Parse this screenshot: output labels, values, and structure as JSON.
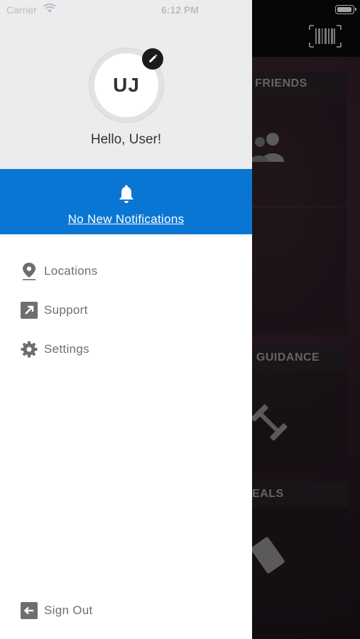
{
  "status_bar": {
    "carrier": "Carrier",
    "time": "6:12 PM"
  },
  "profile": {
    "initials": "UJ",
    "greeting": "Hello, User!"
  },
  "notifications": {
    "text": "No New Notifications"
  },
  "menu": [
    {
      "label": "Locations",
      "icon": "location-pin-icon"
    },
    {
      "label": "Support",
      "icon": "external-link-icon"
    },
    {
      "label": "Settings",
      "icon": "gear-icon"
    }
  ],
  "sign_out": {
    "label": "Sign Out",
    "icon": "sign-out-icon"
  },
  "background_cards": [
    {
      "label": "E FRIENDS"
    },
    {
      "label": "G GUIDANCE"
    },
    {
      "label": "DEALS"
    }
  ],
  "colors": {
    "accent": "#0a76d4",
    "drawer_header": "#ececee",
    "menu_text": "#6e6e6e"
  }
}
